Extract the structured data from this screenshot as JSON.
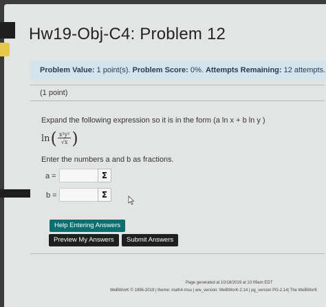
{
  "page": {
    "title": "Hw19-Obj-C4: Problem 12"
  },
  "info_bar": {
    "value_label": "Problem Value:",
    "value": "1 point(s).",
    "score_label": "Problem Score:",
    "score": "0%.",
    "attempts_label": "Attempts Remaining:",
    "attempts": "12 attempts."
  },
  "problem": {
    "points": "(1 point)",
    "instruction": "Expand the following expression so it is in the form (a ln x + b ln y )",
    "expression": {
      "ln": "ln",
      "open_paren": "(",
      "numerator": "x²y²",
      "denominator": "√x",
      "close_paren": ")"
    },
    "enter_text": "Enter the numbers a and b as fractions."
  },
  "answers": {
    "a_label": "a =",
    "b_label": "b =",
    "a_value": "",
    "b_value": "",
    "sigma_symbol": "Σ"
  },
  "buttons": {
    "help": "Help Entering Answers",
    "preview": "Preview My Answers",
    "submit": "Submit Answers"
  },
  "footer": {
    "generated": "Page generated at 10/18/2019 at 10:09am EDT",
    "webwork": "WeBWorK © 1996-2019 | theme: math4-msu | ww_version: WeBWorK-2.14 | pg_version PG-2.14| The WeBWorK"
  },
  "colors": {
    "info_bar_bg": "#d4e3ec",
    "help_button": "#0d6e70",
    "dark_button": "#1f1f1f"
  }
}
